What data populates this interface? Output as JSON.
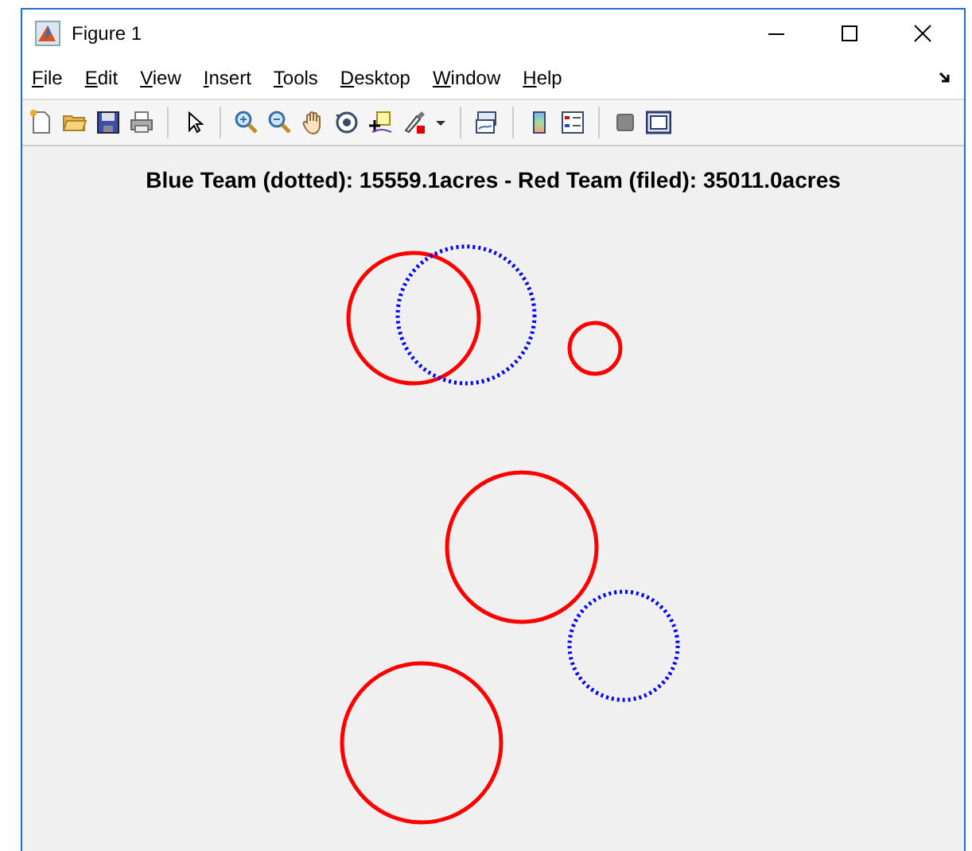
{
  "window": {
    "title": "Figure 1"
  },
  "menu": [
    "File",
    "Edit",
    "View",
    "Insert",
    "Tools",
    "Desktop",
    "Window",
    "Help"
  ],
  "figure": {
    "title": "Blue Team (dotted): 15559.1acres - Red Team (filed): 35011.0acres"
  }
}
